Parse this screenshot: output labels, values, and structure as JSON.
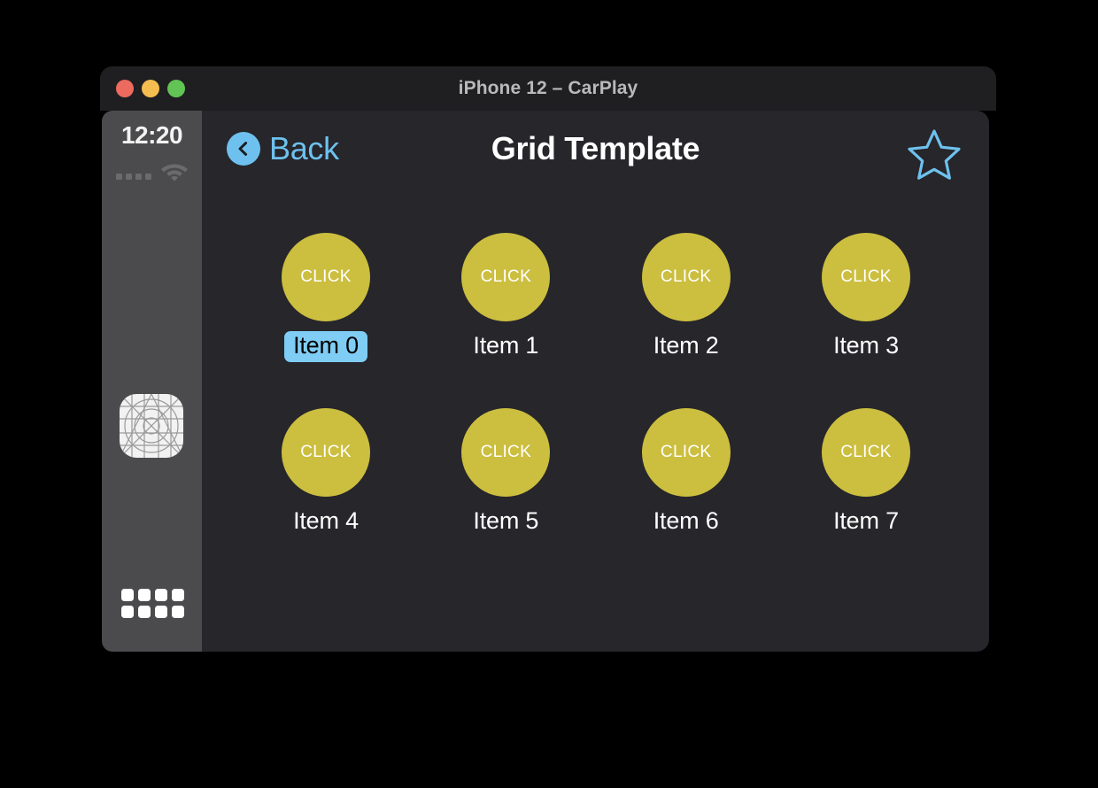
{
  "window": {
    "title": "iPhone 12 – CarPlay",
    "traffic_lights": [
      {
        "name": "close",
        "color": "#ed6a5e"
      },
      {
        "name": "minimize",
        "color": "#f5bd4f"
      },
      {
        "name": "maximize",
        "color": "#61c454"
      }
    ]
  },
  "sidebar": {
    "time": "12:20",
    "signal_bars": 4,
    "wifi_icon": "wifi-icon",
    "app_icon": "app-placeholder-icon",
    "grid_button_icon": "apps-grid-icon"
  },
  "navbar": {
    "back_label": "Back",
    "back_icon": "chevron-left-icon",
    "title": "Grid Template",
    "action_icon": "star-outline-icon"
  },
  "grid": {
    "circle_text": "CLICK",
    "rows": [
      [
        {
          "label": "Item 0",
          "selected": true
        },
        {
          "label": "Item 1",
          "selected": false
        },
        {
          "label": "Item 2",
          "selected": false
        },
        {
          "label": "Item 3",
          "selected": false
        }
      ],
      [
        {
          "label": "Item 4",
          "selected": false
        },
        {
          "label": "Item 5",
          "selected": false
        },
        {
          "label": "Item 6",
          "selected": false
        },
        {
          "label": "Item 7",
          "selected": false
        }
      ]
    ]
  },
  "colors": {
    "accent_blue": "#6ec1ee",
    "selection_blue": "#7fcdf4",
    "item_yellow": "#ccbe3f",
    "content_bg": "#26262b",
    "sidebar_bg": "#4b4b4d",
    "titlebar_bg": "#1f1f21"
  }
}
